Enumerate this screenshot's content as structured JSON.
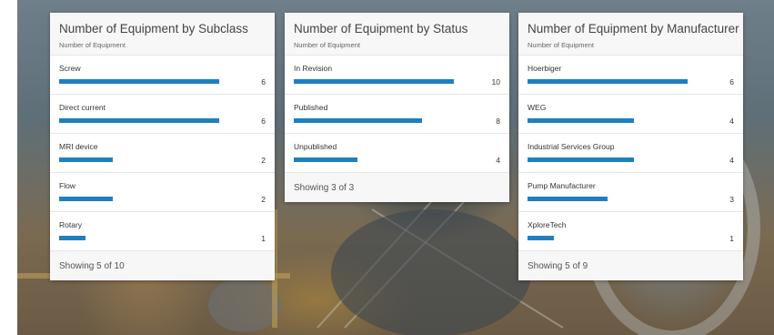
{
  "cards": [
    {
      "title": "Number of Equipment by Subclass",
      "subtitle": "Number of Equipment",
      "max": 6,
      "rows": [
        {
          "label": "Screw",
          "value": 6
        },
        {
          "label": "Direct current",
          "value": 6
        },
        {
          "label": "MRI device",
          "value": 2
        },
        {
          "label": "Flow",
          "value": 2
        },
        {
          "label": "Rotary",
          "value": 1
        }
      ],
      "footer": "Showing 5 of 10"
    },
    {
      "title": "Number of Equipment by Status",
      "subtitle": "Number of Equipment",
      "max": 10,
      "rows": [
        {
          "label": "In Revision",
          "value": 10
        },
        {
          "label": "Published",
          "value": 8
        },
        {
          "label": "Unpublished",
          "value": 4
        }
      ],
      "footer": "Showing 3 of 3"
    },
    {
      "title": "Number of Equipment by Manufacturer",
      "subtitle": "Number of Equipment",
      "max": 6,
      "rows": [
        {
          "label": "Hoerbiger",
          "value": 6
        },
        {
          "label": "WEG",
          "value": 4
        },
        {
          "label": "Industrial Services Group",
          "value": 4
        },
        {
          "label": "Pump Manufacturer",
          "value": 3
        },
        {
          "label": "XploreTech",
          "value": 1
        }
      ],
      "footer": "Showing 5 of 9"
    }
  ],
  "colors": {
    "bar": "#1f7fbf"
  }
}
